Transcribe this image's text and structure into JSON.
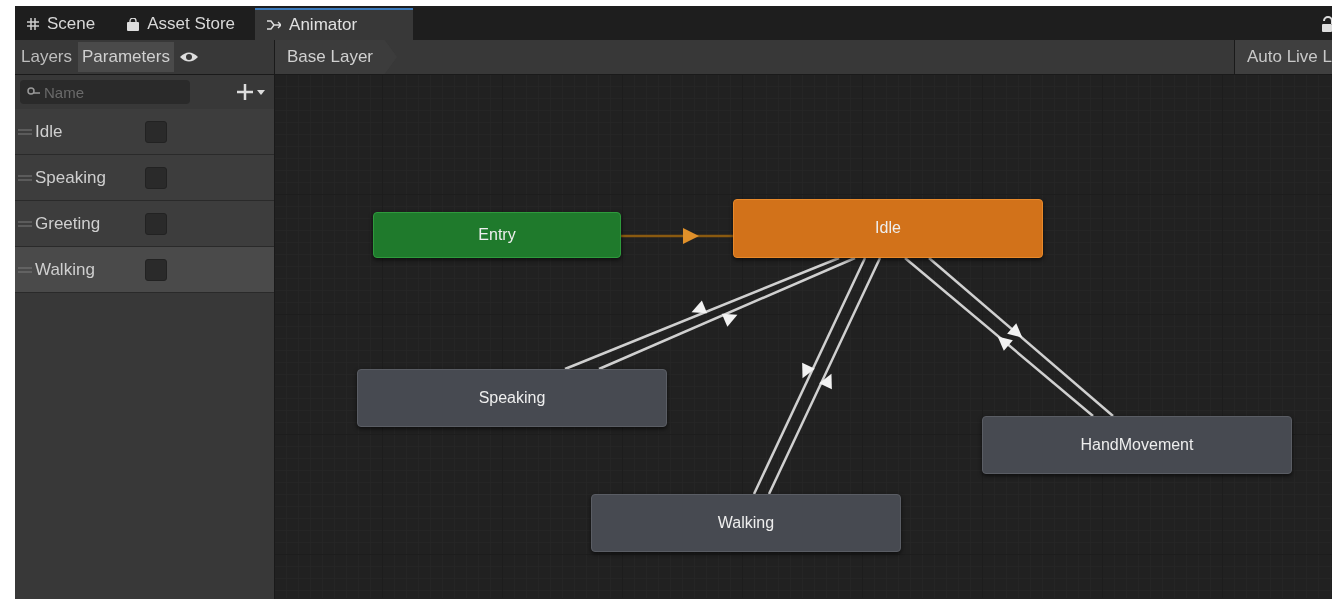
{
  "tabs": [
    {
      "label": "Scene",
      "kind": "grid",
      "selected": false
    },
    {
      "label": "Asset Store",
      "kind": "bag",
      "selected": false
    },
    {
      "label": "Animator",
      "kind": "animator",
      "selected": true
    }
  ],
  "sidebar": {
    "tabs": [
      {
        "label": "Layers",
        "selected": false
      },
      {
        "label": "Parameters",
        "selected": true
      }
    ],
    "search": {
      "placeholder": "Name"
    },
    "parameters": [
      {
        "name": "Idle",
        "checked": false,
        "selected": false
      },
      {
        "name": "Speaking",
        "checked": false,
        "selected": false
      },
      {
        "name": "Greeting",
        "checked": false,
        "selected": false
      },
      {
        "name": "Walking",
        "checked": false,
        "selected": true
      }
    ]
  },
  "breadcrumb": "Base Layer",
  "auto_live_link": "Auto Live L",
  "graph": {
    "states": [
      {
        "name": "Entry",
        "kind": "entry"
      },
      {
        "name": "Idle",
        "kind": "default"
      },
      {
        "name": "Speaking",
        "kind": "normal"
      },
      {
        "name": "Walking",
        "kind": "normal"
      },
      {
        "name": "HandMovement",
        "kind": "normal"
      }
    ]
  }
}
